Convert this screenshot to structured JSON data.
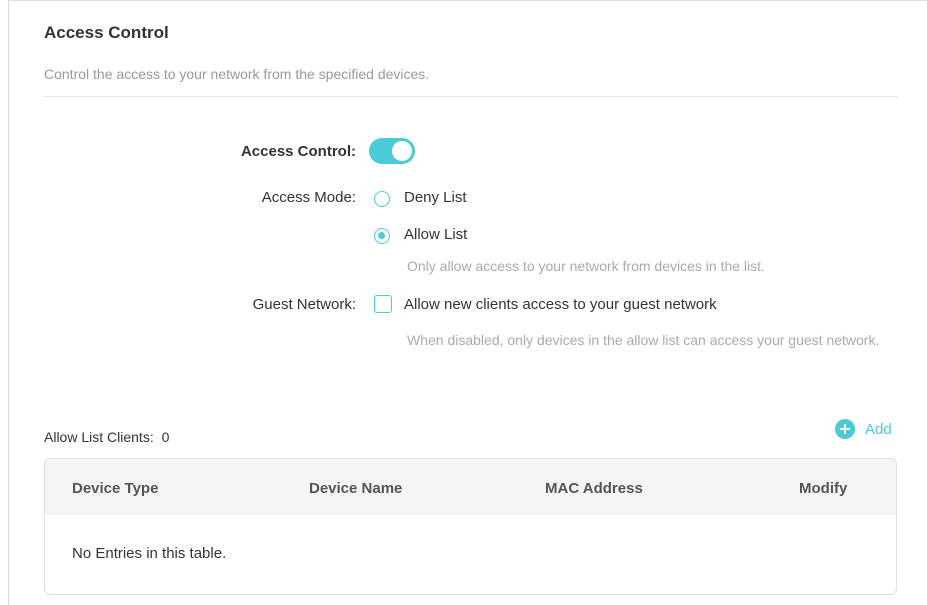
{
  "section": {
    "title": "Access Control",
    "description": "Control the access to your network from the specified devices."
  },
  "access_control": {
    "label": "Access Control:",
    "toggle_enabled": true,
    "accent_color": "#4acbd6"
  },
  "access_mode": {
    "label": "Access Mode:",
    "options": [
      {
        "label": "Deny List",
        "selected": false
      },
      {
        "label": "Allow List",
        "selected": true
      }
    ],
    "hint": "Only allow access to your network from devices in the list."
  },
  "guest_network": {
    "label": "Guest Network:",
    "checkbox_label": "Allow new clients access to your guest network",
    "checked": false,
    "hint": "When disabled, only devices in the allow list can access your guest network."
  },
  "clients": {
    "label": "Allow List Clients:",
    "count": "0",
    "add_label": "Add",
    "add_icon": "plus-circle-icon"
  },
  "table": {
    "columns": [
      "Device Type",
      "Device Name",
      "MAC Address",
      "Modify"
    ],
    "empty_text": "No Entries in this table."
  }
}
